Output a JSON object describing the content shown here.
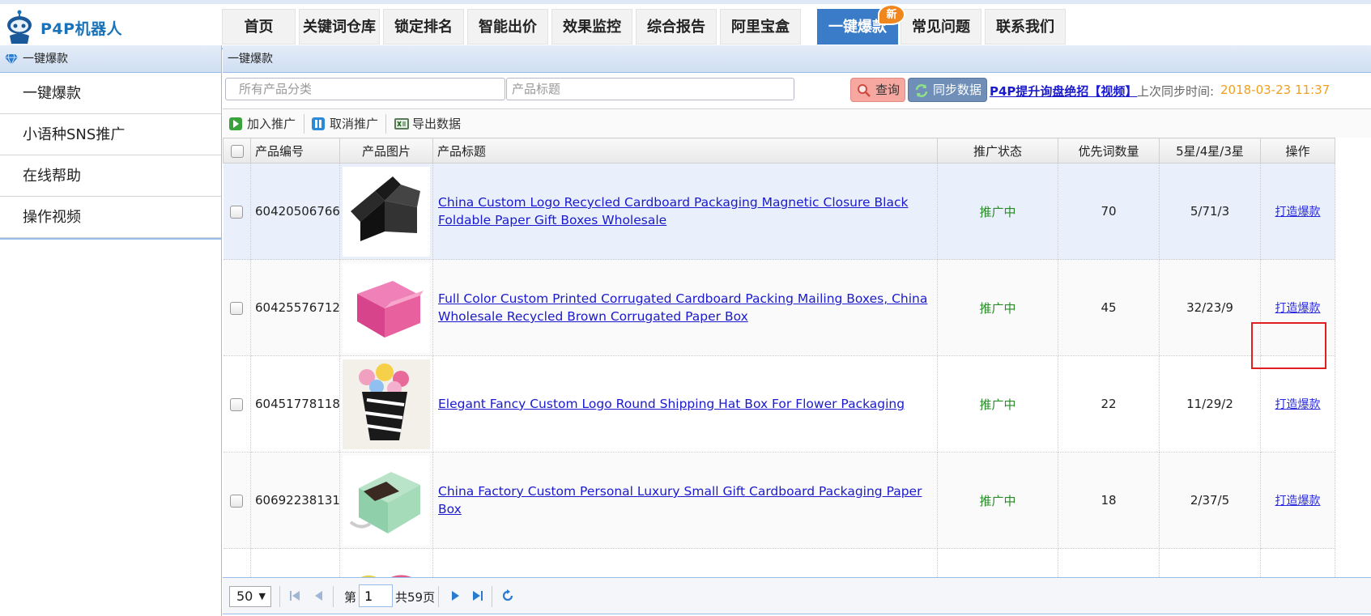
{
  "app": {
    "name": "P4P机器人"
  },
  "nav": {
    "tabs": [
      {
        "label": "首页"
      },
      {
        "label": "关键词仓库"
      },
      {
        "label": "锁定排名"
      },
      {
        "label": "智能出价"
      },
      {
        "label": "效果监控"
      },
      {
        "label": "综合报告"
      },
      {
        "label": "阿里宝盒"
      },
      {
        "label": "一键爆款",
        "active": true
      },
      {
        "label": "常见问题"
      },
      {
        "label": "联系我们"
      }
    ],
    "new_badge": "新"
  },
  "sidebar": {
    "header": "一键爆款",
    "items": [
      {
        "label": "一键爆款"
      },
      {
        "label": "小语种SNS推广"
      },
      {
        "label": "在线帮助"
      },
      {
        "label": "操作视频"
      }
    ]
  },
  "panel": {
    "title": "一键爆款"
  },
  "search": {
    "category_placeholder": "所有产品分类",
    "title_placeholder": "产品标题",
    "query_label": "查询",
    "sync_label": "同步数据",
    "video_link": "P4P提升询盘绝招【视频】",
    "last_sync_label": "上次同步时间:",
    "last_sync_time": "2018-03-23 11:37"
  },
  "toolbar": {
    "add_label": "加入推广",
    "cancel_label": "取消推广",
    "export_label": "导出数据"
  },
  "table": {
    "columns": [
      "产品编号",
      "产品图片",
      "产品标题",
      "推广状态",
      "优先词数量",
      "5星/4星/3星",
      "操作"
    ],
    "rows": [
      {
        "id": "60420506766",
        "title": "China Custom Logo Recycled Cardboard Packaging Magnetic Closure Black Foldable Paper Gift Boxes Wholesale",
        "status": "推广中",
        "priority_count": "70",
        "stars": "5/71/3",
        "action": "打造爆款"
      },
      {
        "id": "60425576712",
        "title": "Full Color Custom Printed Corrugated Cardboard Packing Mailing Boxes, China Wholesale Recycled Brown Corrugated Paper Box",
        "status": "推广中",
        "priority_count": "45",
        "stars": "32/23/9",
        "action": "打造爆款"
      },
      {
        "id": "60451778118",
        "title": "Elegant Fancy Custom Logo Round Shipping Hat Box For Flower Packaging",
        "status": "推广中",
        "priority_count": "22",
        "stars": "11/29/2",
        "action": "打造爆款"
      },
      {
        "id": "60692238131",
        "title": "China Factory Custom Personal Luxury Small Gift Cardboard Packaging Paper Box",
        "status": "推广中",
        "priority_count": "18",
        "stars": "2/37/5",
        "action": "打造爆款"
      }
    ]
  },
  "pager": {
    "page_size": "50",
    "page_label_pre": "第",
    "current_page": "1",
    "page_label_post": "共59页"
  },
  "colors": {
    "accent": "#3a7cc7",
    "status_green": "#2a8a2a",
    "link_blue": "#1a1acc",
    "highlight_red": "#e02020"
  }
}
